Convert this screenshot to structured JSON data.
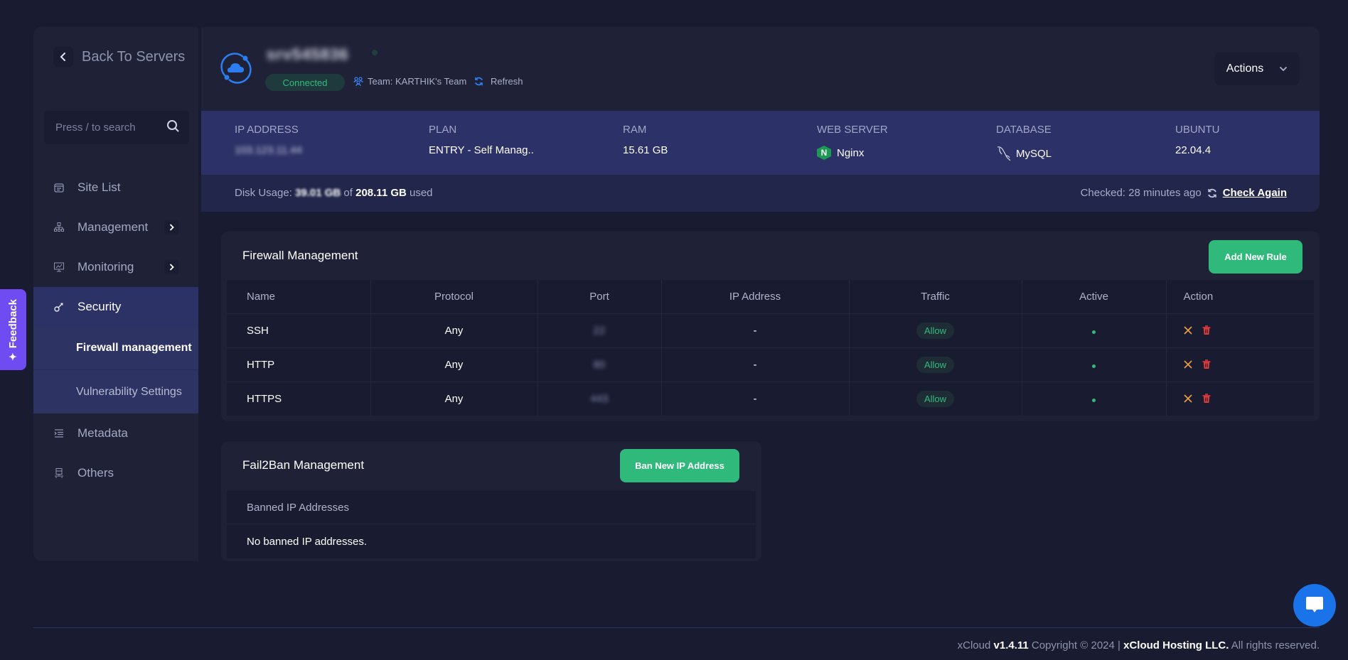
{
  "sidebar": {
    "back_label": "Back To Servers",
    "search_placeholder": "Press / to search",
    "items": [
      {
        "label": "Site List",
        "icon": "browser-window-icon"
      },
      {
        "label": "Management",
        "icon": "sitemap-icon",
        "expandable": true
      },
      {
        "label": "Monitoring",
        "icon": "monitor-chart-icon",
        "expandable": true
      },
      {
        "label": "Security",
        "icon": "key-icon",
        "active": true
      },
      {
        "label": "Metadata",
        "icon": "list-indent-icon"
      },
      {
        "label": "Others",
        "icon": "server-icon"
      }
    ],
    "security_subitems": [
      {
        "label": "Firewall management",
        "active": true
      },
      {
        "label": "Vulnerability Settings"
      }
    ]
  },
  "feedback": {
    "label": "Feedback"
  },
  "header": {
    "server_name": "srv545836",
    "status": "Connected",
    "team": "Team: KARTHIK's Team",
    "refresh_label": "Refresh",
    "actions_label": "Actions"
  },
  "info": {
    "ip_label": "IP ADDRESS",
    "ip_value": "103.123.11.44",
    "plan_label": "PLAN",
    "plan_value": "ENTRY - Self Manag..",
    "ram_label": "RAM",
    "ram_value": "15.61 GB",
    "webserver_label": "WEB SERVER",
    "webserver_value": "Nginx",
    "database_label": "DATABASE",
    "database_value": "MySQL",
    "os_label": "UBUNTU",
    "os_value": "22.04.4"
  },
  "disk": {
    "prefix": "Disk Usage:",
    "used": "39.01 GB",
    "of": "of",
    "total": "208.11 GB",
    "suffix": "used",
    "checked": "Checked: 28 minutes ago",
    "check_again": "Check Again"
  },
  "firewall": {
    "title": "Firewall Management",
    "add_button": "Add New Rule",
    "columns": [
      "Name",
      "Protocol",
      "Port",
      "IP Address",
      "Traffic",
      "Active",
      "Action"
    ],
    "rows": [
      {
        "name": "SSH",
        "protocol": "Any",
        "port": "22",
        "ip": "-",
        "traffic": "Allow",
        "active": true
      },
      {
        "name": "HTTP",
        "protocol": "Any",
        "port": "80",
        "ip": "-",
        "traffic": "Allow",
        "active": true
      },
      {
        "name": "HTTPS",
        "protocol": "Any",
        "port": "443",
        "ip": "-",
        "traffic": "Allow",
        "active": true
      }
    ]
  },
  "fail2ban": {
    "title": "Fail2Ban Management",
    "ban_button": "Ban New IP Address",
    "column": "Banned IP Addresses",
    "empty": "No banned IP addresses."
  },
  "footer": {
    "brand": "xCloud",
    "version": "v1.4.11",
    "copyright": "Copyright © 2024 |",
    "company": "xCloud Hosting LLC.",
    "rights": "All rights reserved."
  },
  "colors": {
    "accent_green": "#2fb97a",
    "active_nav": "#2c3166",
    "feedback": "#6e4cf2",
    "chat": "#1a73e8",
    "danger": "#e03a3a",
    "warning": "#f0a040"
  }
}
